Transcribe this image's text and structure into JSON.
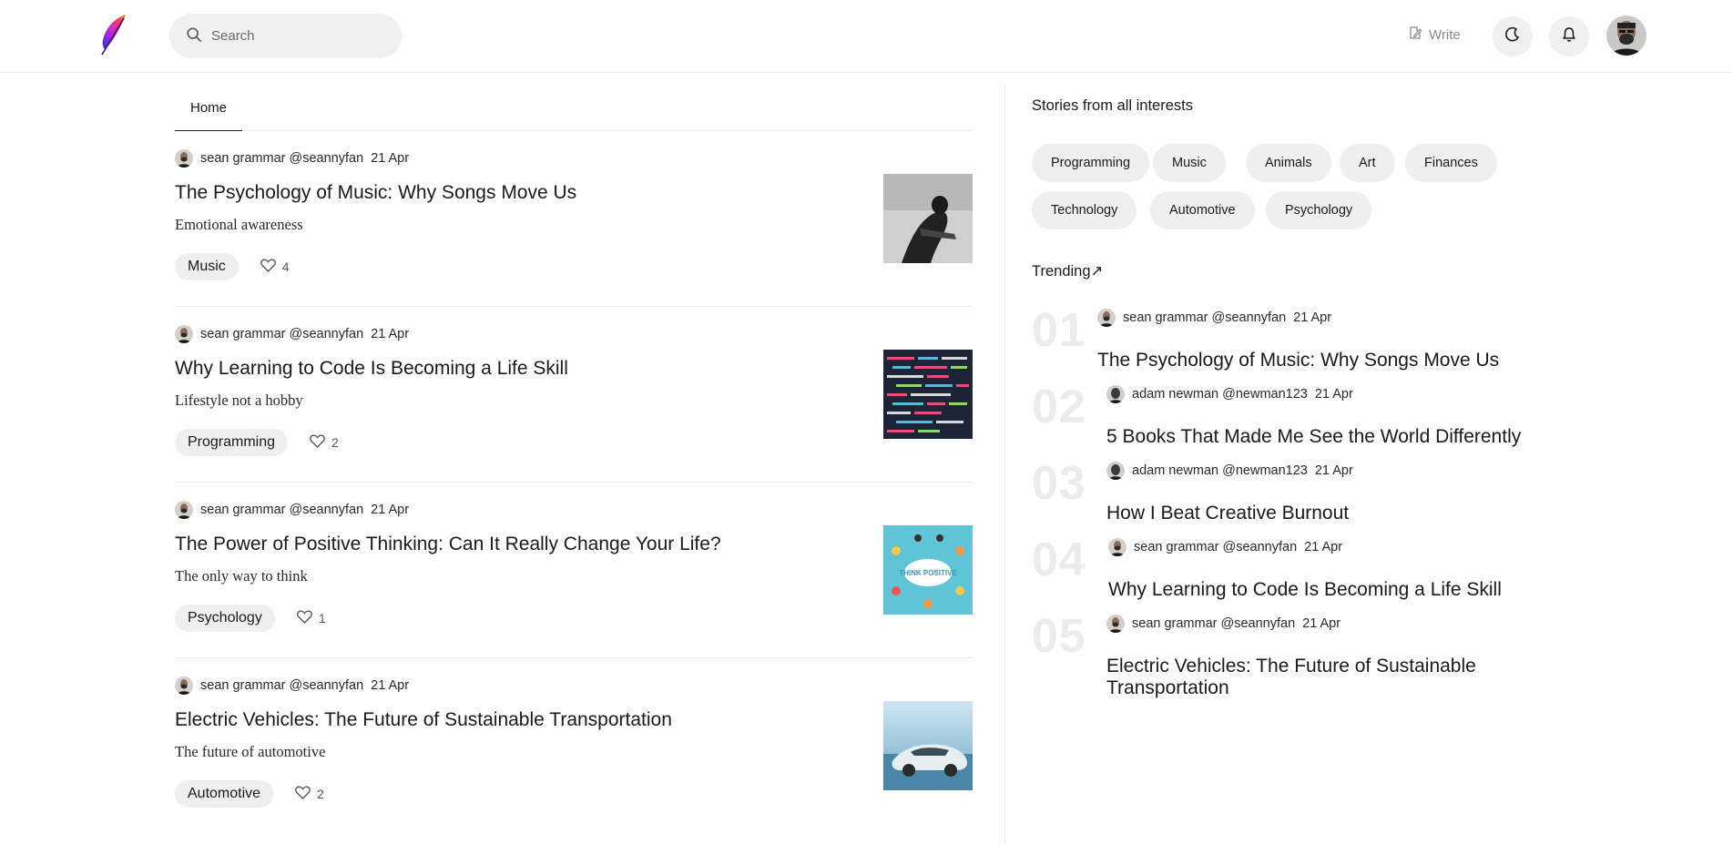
{
  "header": {
    "search_placeholder": "Search",
    "write_label": "Write"
  },
  "tabs": [
    {
      "label": "Home"
    }
  ],
  "feed": [
    {
      "author": "sean grammar @seannyfan",
      "date": "21 Apr",
      "title": "The Psychology of Music: Why Songs Move Us",
      "subtitle": "Emotional awareness",
      "tag": "Music",
      "likes": "4"
    },
    {
      "author": "sean grammar @seannyfan",
      "date": "21 Apr",
      "title": "Why Learning to Code Is Becoming a Life Skill",
      "subtitle": "Lifestyle not a hobby",
      "tag": "Programming",
      "likes": "2"
    },
    {
      "author": "sean grammar @seannyfan",
      "date": "21 Apr",
      "title": "The Power of Positive Thinking: Can It Really Change Your Life?",
      "subtitle": "The only way to think",
      "tag": "Psychology",
      "likes": "1",
      "thumb_text": "THINK POSITIVE"
    },
    {
      "author": "sean grammar @seannyfan",
      "date": "21 Apr",
      "title": "Electric Vehicles: The Future of Sustainable Transportation",
      "subtitle": "The future of automotive",
      "tag": "Automotive",
      "likes": "2"
    }
  ],
  "sidebar": {
    "interests_heading": "Stories from all interests",
    "topics": [
      "Programming",
      "Music",
      "Animals",
      "Art",
      "Finances",
      "Technology",
      "Automotive",
      "Psychology"
    ],
    "trending_heading": "Trending↗",
    "trending": [
      {
        "num": "01",
        "author": "sean grammar @seannyfan",
        "date": "21 Apr",
        "title": "The Psychology of Music: Why Songs Move Us"
      },
      {
        "num": "02",
        "author": "adam newman @newman123",
        "date": "21 Apr",
        "title": "5 Books That Made Me See the World Differently"
      },
      {
        "num": "03",
        "author": "adam newman @newman123",
        "date": "21 Apr",
        "title": "How I Beat Creative Burnout"
      },
      {
        "num": "04",
        "author": "sean grammar @seannyfan",
        "date": "21 Apr",
        "title": "Why Learning to Code Is Becoming a Life Skill"
      },
      {
        "num": "05",
        "author": "sean grammar @seannyfan",
        "date": "21 Apr",
        "title": "Electric Vehicles: The Future of Sustainable Transportation"
      }
    ]
  },
  "colors": {
    "accent_purple": "#6a2bd6",
    "accent_orange": "#ff6a2a",
    "chip_bg": "#efefef",
    "divider": "#ececec"
  }
}
